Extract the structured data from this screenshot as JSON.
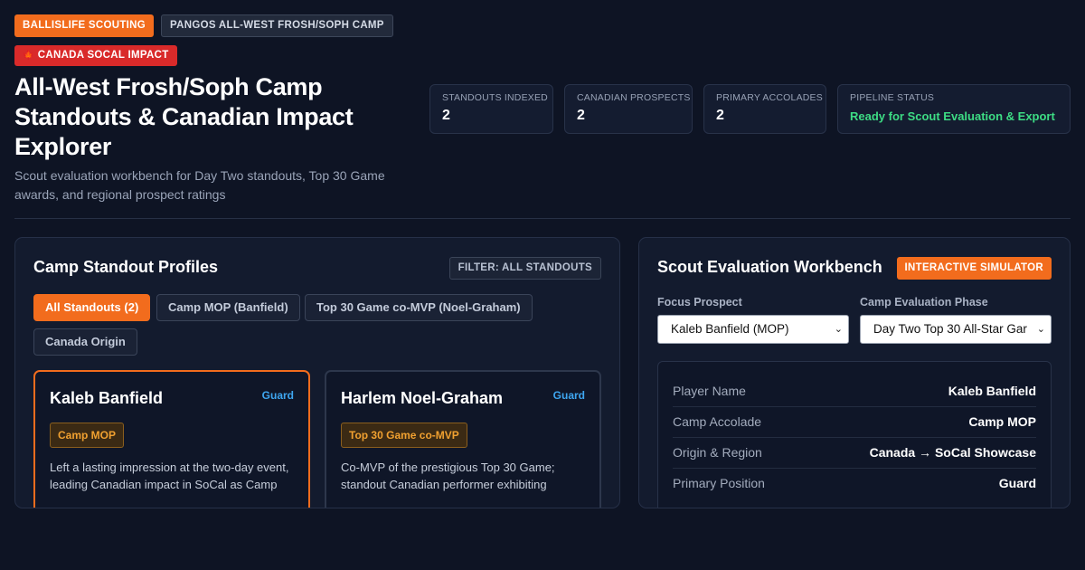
{
  "header": {
    "badge_primary": "BALLISLIFE SCOUTING",
    "badge_event": "PANGOS ALL-WEST FROSH/SOPH CAMP",
    "badge_impact": "CANADA SOCAL IMPACT",
    "title": "All-West Frosh/Soph Camp Standouts & Canadian Impact Explorer",
    "subtitle": "Scout evaluation workbench for Day Two standouts, Top 30 Game awards, and regional prospect ratings"
  },
  "stats": [
    {
      "label": "STANDOUTS INDEXED",
      "value": "2"
    },
    {
      "label": "CANADIAN PROSPECTS",
      "value": "2"
    },
    {
      "label": "PRIMARY ACCOLADES",
      "value": "2"
    },
    {
      "label": "PIPELINE STATUS",
      "value": "Ready for Scout Evaluation & Export"
    }
  ],
  "colors": {
    "accent": "#f26c1d",
    "status_green": "#3ddc84",
    "position_blue": "#3ea6f0",
    "impact_red": "#d92a2a"
  },
  "profiles_panel": {
    "title": "Camp Standout Profiles",
    "filter_tag": "FILTER: ALL STANDOUTS",
    "filters": [
      "All Standouts (2)",
      "Camp MOP (Banfield)",
      "Top 30 Game co-MVP (Noel-Graham)",
      "Canada Origin"
    ],
    "cards": [
      {
        "name": "Kaleb Banfield",
        "position": "Guard",
        "award": "Camp MOP",
        "description": "Left a lasting impression at the two-day event, leading Canadian impact in SoCal as Camp"
      },
      {
        "name": "Harlem Noel-Graham",
        "position": "Guard",
        "award": "Top 30 Game co-MVP",
        "description": "Co-MVP of the prestigious Top 30 Game; standout Canadian performer exhibiting"
      }
    ]
  },
  "workbench": {
    "title": "Scout Evaluation Workbench",
    "tag": "INTERACTIVE SIMULATOR",
    "focus_label": "Focus Prospect",
    "focus_value": "Kaleb Banfield (MOP)",
    "phase_label": "Camp Evaluation Phase",
    "phase_value": "Day Two Top 30 All-Star Gar",
    "details": [
      {
        "key": "Player Name",
        "value": "Kaleb Banfield"
      },
      {
        "key": "Camp Accolade",
        "value": "Camp MOP"
      },
      {
        "key": "Origin & Region",
        "value": "Canada → SoCal Showcase"
      },
      {
        "key": "Primary Position",
        "value": "Guard"
      }
    ]
  }
}
